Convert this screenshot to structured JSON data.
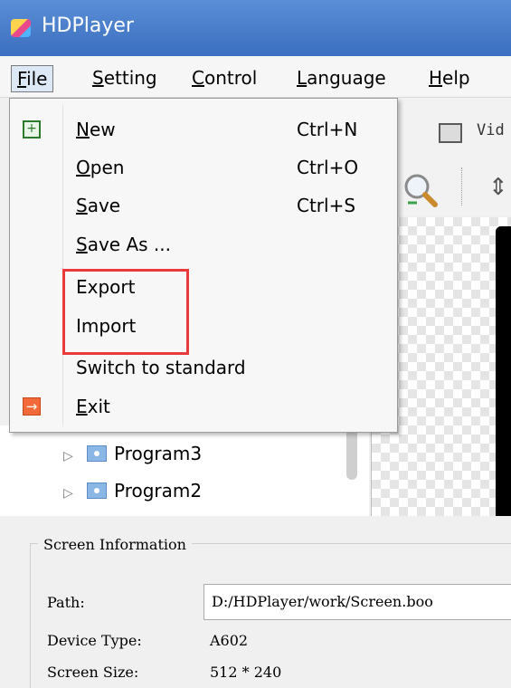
{
  "window": {
    "title": "HDPlayer",
    "app_icon": "hdplayer-icon"
  },
  "menubar": [
    {
      "label": "File",
      "accel": "F",
      "rest": "ile"
    },
    {
      "label": "Setting",
      "accel": "S",
      "rest": "etting"
    },
    {
      "label": "Control",
      "accel": "C",
      "rest": "ontrol"
    },
    {
      "label": "Language",
      "accel": "L",
      "rest": "anguage"
    },
    {
      "label": "Help",
      "accel": "H",
      "rest": "elp"
    }
  ],
  "file_menu": {
    "items": [
      {
        "accel": "N",
        "rest": "ew",
        "shortcut": "Ctrl+N",
        "icon": "new-screen-icon"
      },
      {
        "accel": "O",
        "rest": "pen",
        "shortcut": "Ctrl+O"
      },
      {
        "accel": "S",
        "rest": "ave",
        "shortcut": "Ctrl+S"
      },
      {
        "accel": "S",
        "rest": "ave As ...",
        "shortcut": ""
      },
      {
        "accel": "",
        "rest": "Export",
        "shortcut": ""
      },
      {
        "accel": "",
        "rest": "Import",
        "shortcut": ""
      },
      {
        "accel": "",
        "rest": "Switch to standard",
        "shortcut": ""
      },
      {
        "accel": "E",
        "rest": "xit",
        "shortcut": "",
        "icon": "exit-icon"
      }
    ],
    "highlight_color": "#e83a3a"
  },
  "toolbar": {
    "video_label": "Vid"
  },
  "tree": {
    "items": [
      "Program3",
      "Program2"
    ]
  },
  "screen_info": {
    "title": "Screen Information",
    "path_label": "Path:",
    "path_value": "D:/HDPlayer/work/Screen.boo",
    "device_type_label": "Device Type:",
    "device_type_value": "A602",
    "screen_size_label": "Screen Size:",
    "screen_size_value": "512 * 240"
  }
}
